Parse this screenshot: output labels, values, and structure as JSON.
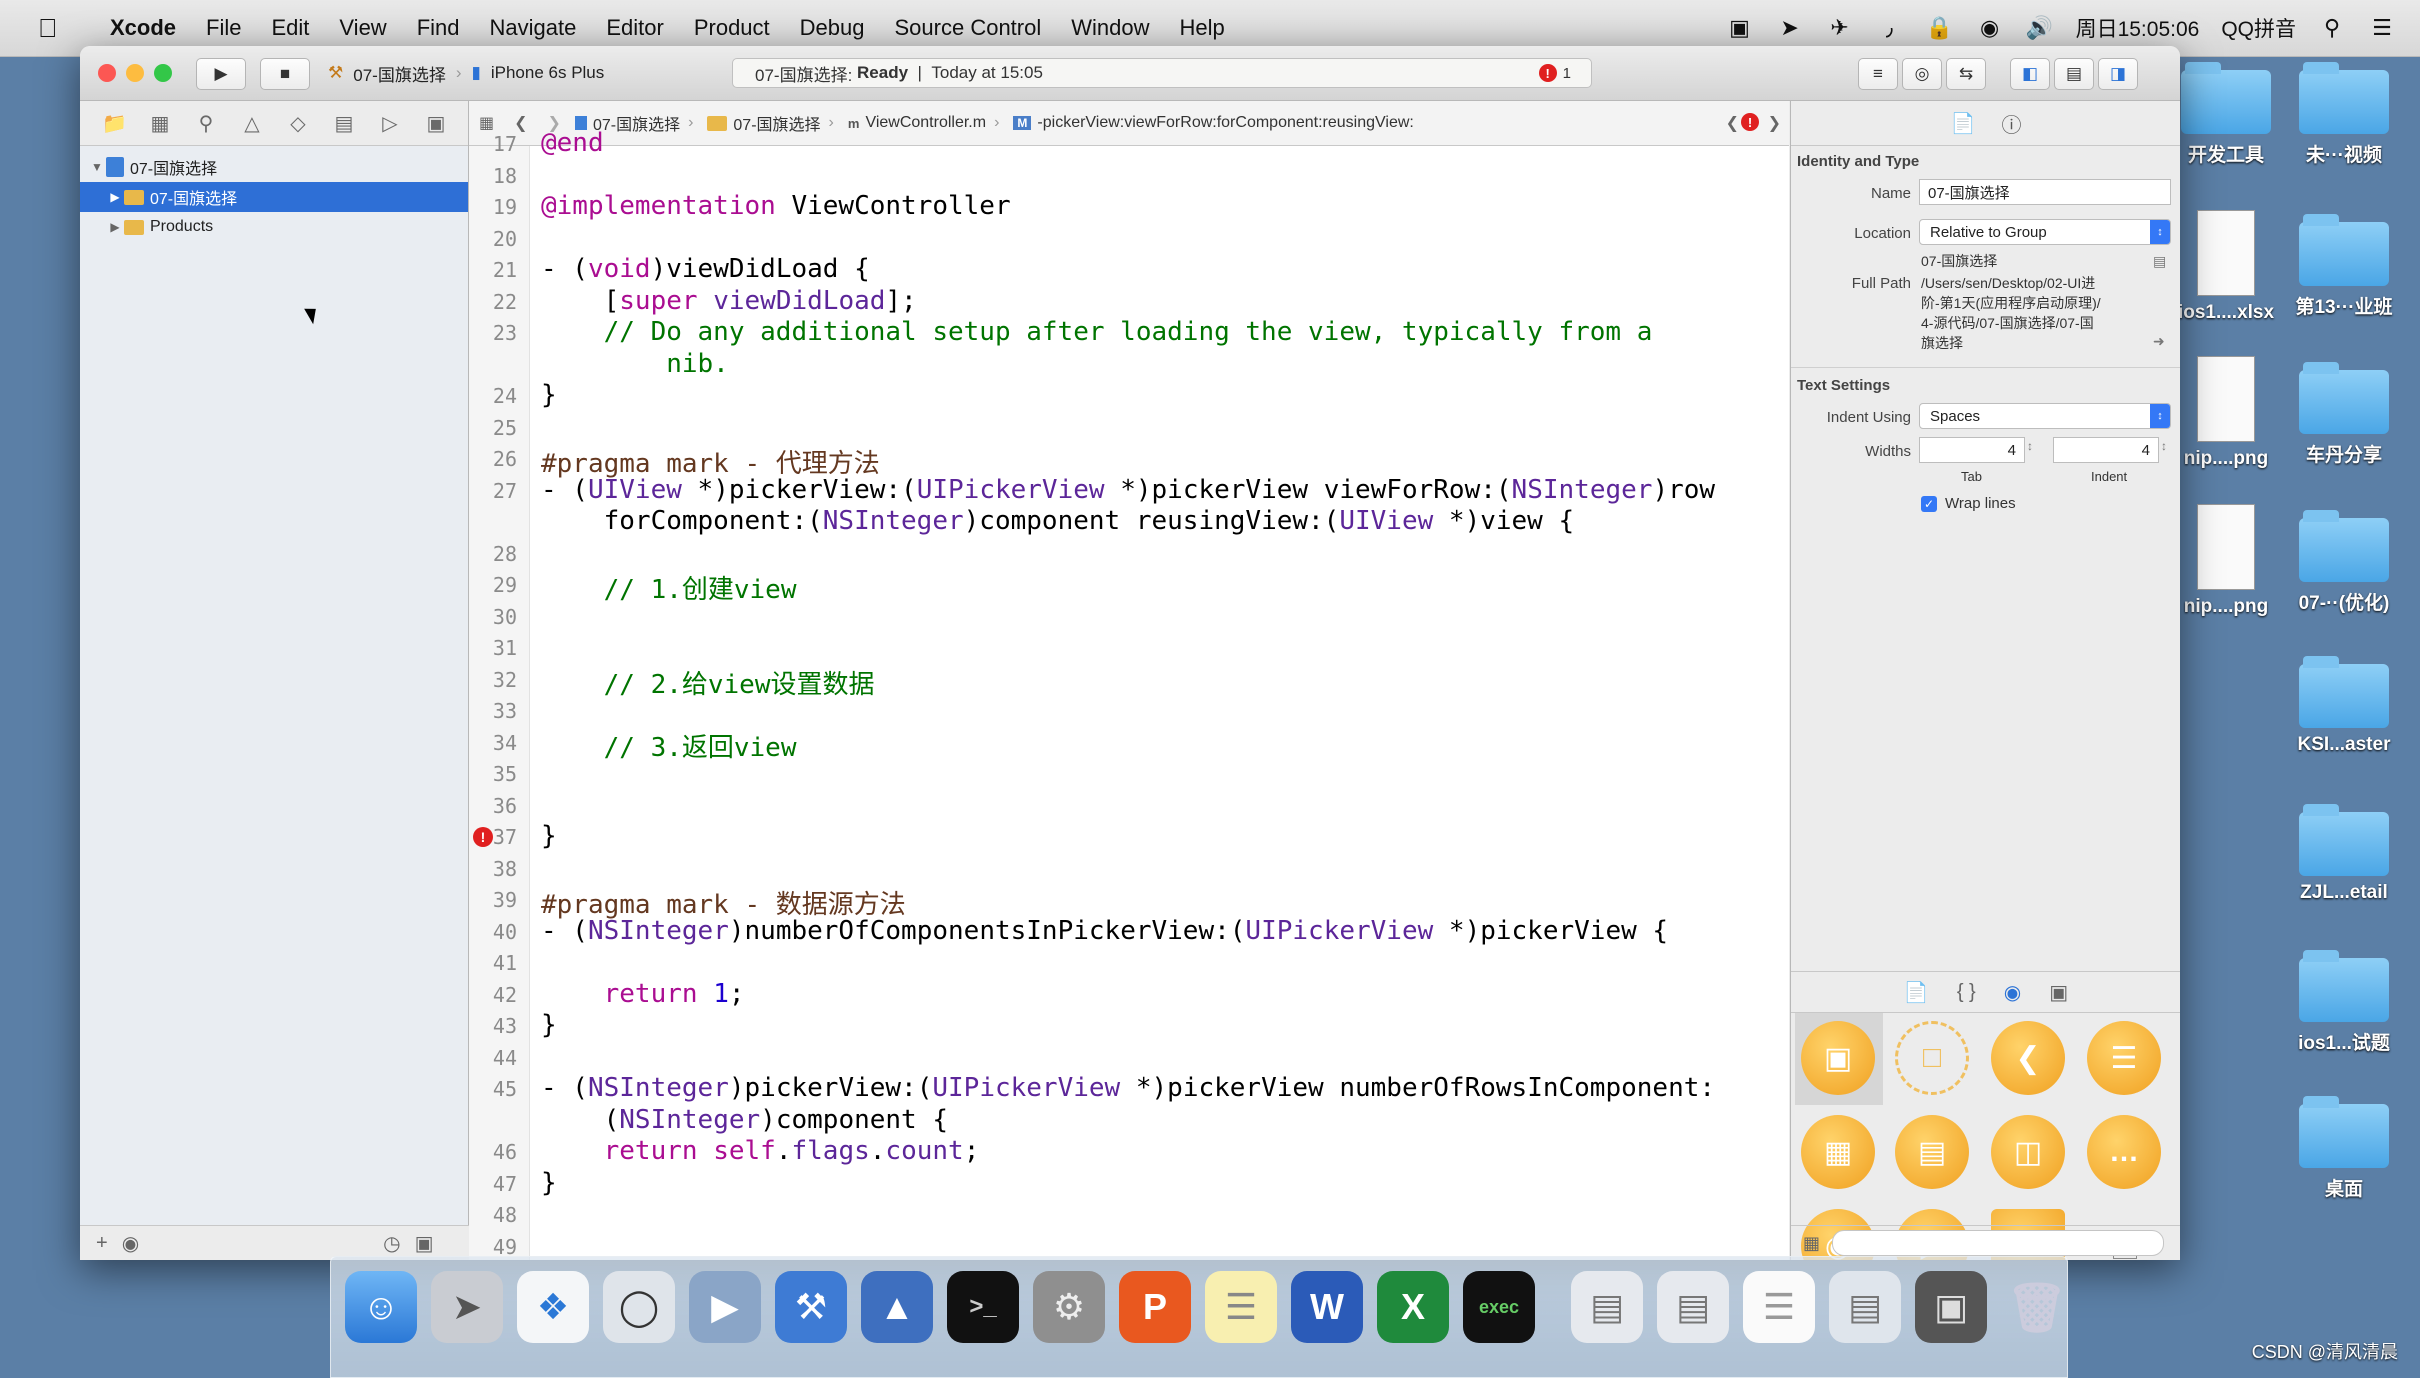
{
  "menubar": {
    "items": [
      "Xcode",
      "File",
      "Edit",
      "View",
      "Find",
      "Navigate",
      "Editor",
      "Product",
      "Debug",
      "Source Control",
      "Window",
      "Help"
    ],
    "clock": "周日15:05:06",
    "input_method": "QQ拼音"
  },
  "toolbar": {
    "scheme": "07-国旗选择",
    "device": "iPhone 6s Plus",
    "status_project": "07-国旗选择:",
    "status_state": "Ready",
    "status_time": "Today at 15:05",
    "error_count": "1"
  },
  "navigator": {
    "project": "07-国旗选择",
    "group": "07-国旗选择",
    "products": "Products"
  },
  "jumpbar": {
    "crumbs": [
      "07-国旗选择",
      "07-国旗选择",
      "ViewController.m",
      "-pickerView:viewForRow:forComponent:reusingView:"
    ]
  },
  "editor": {
    "lines": [
      {
        "n": "17",
        "segs": [
          {
            "c": "kw",
            "t": "@end"
          }
        ]
      },
      {
        "n": "18",
        "segs": []
      },
      {
        "n": "19",
        "segs": [
          {
            "c": "kw",
            "t": "@implementation"
          },
          {
            "c": "",
            "t": " ViewController"
          }
        ]
      },
      {
        "n": "20",
        "segs": []
      },
      {
        "n": "21",
        "segs": [
          {
            "c": "",
            "t": "- ("
          },
          {
            "c": "kw",
            "t": "void"
          },
          {
            "c": "",
            "t": ")viewDidLoad {"
          }
        ]
      },
      {
        "n": "22",
        "segs": [
          {
            "c": "",
            "t": "    ["
          },
          {
            "c": "kw",
            "t": "super"
          },
          {
            "c": "",
            "t": " "
          },
          {
            "c": "ty",
            "t": "viewDidLoad"
          },
          {
            "c": "",
            "t": "];"
          }
        ]
      },
      {
        "n": "23",
        "segs": [
          {
            "c": "cm",
            "t": "    // Do any additional setup after loading the view, typically from a"
          }
        ]
      },
      {
        "n": "",
        "segs": [
          {
            "c": "cm",
            "t": "        nib."
          }
        ]
      },
      {
        "n": "24",
        "segs": [
          {
            "c": "",
            "t": "}"
          }
        ]
      },
      {
        "n": "25",
        "segs": []
      },
      {
        "n": "26",
        "segs": [
          {
            "c": "dir",
            "t": "#pragma mark - 代理方法"
          }
        ]
      },
      {
        "n": "27",
        "segs": [
          {
            "c": "",
            "t": "- ("
          },
          {
            "c": "ty",
            "t": "UIView"
          },
          {
            "c": "",
            "t": " *)pickerView:("
          },
          {
            "c": "ty",
            "t": "UIPickerView"
          },
          {
            "c": "",
            "t": " *)pickerView viewForRow:("
          },
          {
            "c": "ty",
            "t": "NSInteger"
          },
          {
            "c": "",
            "t": ")row"
          }
        ]
      },
      {
        "n": "",
        "segs": [
          {
            "c": "",
            "t": "    forComponent:("
          },
          {
            "c": "ty",
            "t": "NSInteger"
          },
          {
            "c": "",
            "t": ")component reusingView:("
          },
          {
            "c": "ty",
            "t": "UIView"
          },
          {
            "c": "",
            "t": " *)view {"
          }
        ]
      },
      {
        "n": "28",
        "segs": []
      },
      {
        "n": "29",
        "segs": [
          {
            "c": "cm",
            "t": "    // 1.创建view"
          }
        ]
      },
      {
        "n": "30",
        "segs": []
      },
      {
        "n": "31",
        "segs": []
      },
      {
        "n": "32",
        "segs": [
          {
            "c": "cm",
            "t": "    // 2.给view设置数据"
          }
        ]
      },
      {
        "n": "33",
        "segs": []
      },
      {
        "n": "34",
        "segs": [
          {
            "c": "cm",
            "t": "    // 3.返回view"
          }
        ]
      },
      {
        "n": "35",
        "segs": []
      },
      {
        "n": "36",
        "segs": []
      },
      {
        "n": "37",
        "segs": [
          {
            "c": "",
            "t": "}"
          }
        ],
        "error": true
      },
      {
        "n": "38",
        "segs": []
      },
      {
        "n": "39",
        "segs": [
          {
            "c": "dir",
            "t": "#pragma mark - 数据源方法"
          }
        ]
      },
      {
        "n": "40",
        "segs": [
          {
            "c": "",
            "t": "- ("
          },
          {
            "c": "ty",
            "t": "NSInteger"
          },
          {
            "c": "",
            "t": ")numberOfComponentsInPickerView:("
          },
          {
            "c": "ty",
            "t": "UIPickerView"
          },
          {
            "c": "",
            "t": " *)pickerView {"
          }
        ]
      },
      {
        "n": "41",
        "segs": []
      },
      {
        "n": "42",
        "segs": [
          {
            "c": "",
            "t": "    "
          },
          {
            "c": "kw",
            "t": "return"
          },
          {
            "c": "",
            "t": " "
          },
          {
            "c": "nm",
            "t": "1"
          },
          {
            "c": "",
            "t": ";"
          }
        ]
      },
      {
        "n": "43",
        "segs": [
          {
            "c": "",
            "t": "}"
          }
        ]
      },
      {
        "n": "44",
        "segs": []
      },
      {
        "n": "45",
        "segs": [
          {
            "c": "",
            "t": "- ("
          },
          {
            "c": "ty",
            "t": "NSInteger"
          },
          {
            "c": "",
            "t": ")pickerView:("
          },
          {
            "c": "ty",
            "t": "UIPickerView"
          },
          {
            "c": "",
            "t": " *)pickerView numberOfRowsInComponent:"
          }
        ]
      },
      {
        "n": "",
        "segs": [
          {
            "c": "",
            "t": "    ("
          },
          {
            "c": "ty",
            "t": "NSInteger"
          },
          {
            "c": "",
            "t": ")component {"
          }
        ]
      },
      {
        "n": "46",
        "segs": [
          {
            "c": "",
            "t": "    "
          },
          {
            "c": "kw",
            "t": "return"
          },
          {
            "c": "",
            "t": " "
          },
          {
            "c": "kw",
            "t": "self"
          },
          {
            "c": "",
            "t": "."
          },
          {
            "c": "ty",
            "t": "flags"
          },
          {
            "c": "",
            "t": "."
          },
          {
            "c": "ty",
            "t": "count"
          },
          {
            "c": "",
            "t": ";"
          }
        ]
      },
      {
        "n": "47",
        "segs": [
          {
            "c": "",
            "t": "}"
          }
        ]
      },
      {
        "n": "48",
        "segs": []
      },
      {
        "n": "49",
        "segs": []
      }
    ]
  },
  "inspector": {
    "identity_title": "Identity and Type",
    "name_label": "Name",
    "name_value": "07-国旗选择",
    "location_label": "Location",
    "location_value": "Relative to Group",
    "location_path": "07-国旗选择",
    "fullpath_label": "Full Path",
    "fullpath_lines": [
      "/Users/sen/Desktop/02-UI进",
      "阶-第1天(应用程序启动原理)/",
      "4-源代码/07-国旗选择/07-国",
      "旗选择"
    ],
    "text_settings_title": "Text Settings",
    "indent_using_label": "Indent Using",
    "indent_using_value": "Spaces",
    "widths_label": "Widths",
    "tab_value": "4",
    "indent_value": "4",
    "tab_caption": "Tab",
    "indent_caption": "Indent",
    "wrap_label": "Wrap lines"
  },
  "desktop": {
    "items": [
      "开发工具",
      "未···视频",
      "ios1....xlsx",
      "第13···业班",
      "nip....png",
      "车丹分享",
      "nip....png",
      "07-··(优化)",
      "KSI...aster",
      "ZJL...etail",
      "ios1...试题",
      "桌面"
    ]
  },
  "watermark": "CSDN @清风清晨"
}
